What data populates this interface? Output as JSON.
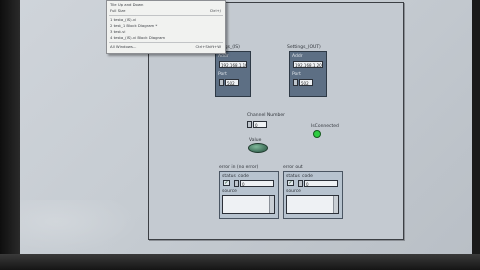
{
  "menu": {
    "items": [
      {
        "label": "Tile Up and Down",
        "shortcut": ""
      },
      {
        "label": "Full Size",
        "shortcut": "Ctrl+/"
      },
      {
        "label": "1 testa_(IS).vi",
        "shortcut": ""
      },
      {
        "label": "2 test_1 Block Diagram *",
        "shortcut": ""
      },
      {
        "label": "3 test.vi",
        "shortcut": ""
      },
      {
        "label": "4 testa_(IS).vi Block Diagram",
        "shortcut": ""
      },
      {
        "label": "All Windows...",
        "shortcut": "Ctrl+Shift+W"
      }
    ]
  },
  "panel": {
    "left_cluster": {
      "title": "settings_(IS)",
      "address_label": "Addr",
      "address_value": "192.168.1.10",
      "port_label": "Port",
      "port_value": "502"
    },
    "right_cluster": {
      "title": "Settings_(OUT)",
      "address_label": "Addr",
      "address_value": "192.168.1.20",
      "port_label": "Port",
      "port_value": "502"
    },
    "channel_label": "Channel Number",
    "channel_value": "0",
    "connected_label": "IsConnected",
    "value_label": "Value",
    "error_in": {
      "title": "error in (no error)",
      "status_label": "status",
      "code_label": "code",
      "code_value": "0",
      "source_label": "source",
      "checkmark": "✓"
    },
    "error_out": {
      "title": "error out",
      "status_label": "status",
      "code_label": "code",
      "code_value": "0",
      "source_label": "source",
      "checkmark": "✓"
    }
  },
  "colors": {
    "cluster": "#5d6f84",
    "led_on": "#2ecc40",
    "knob": "#3f6f5a"
  }
}
